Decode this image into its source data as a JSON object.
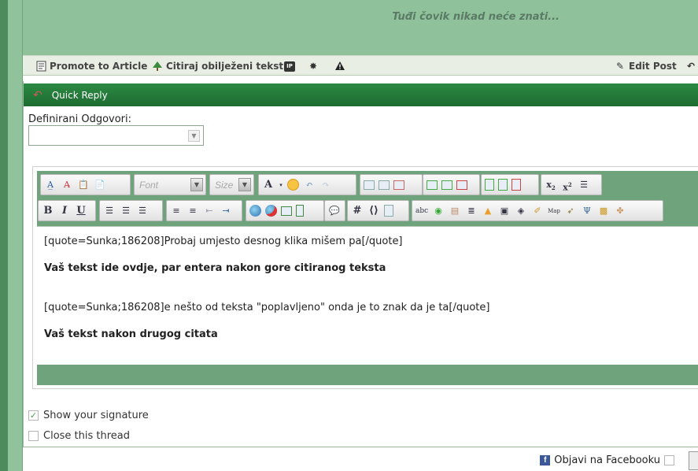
{
  "post": {
    "signature": "Tuđi čovik nikad neće znati...",
    "toolbar": {
      "promote_label": "Promote to Article",
      "quote_label": "Citiraj obilježeni tekst",
      "ip_label": "IP",
      "edit_label": "Edit Post"
    }
  },
  "quick_reply": {
    "title": "Quick Reply",
    "predefined_label": "Definirani Odgovori:",
    "predefined_value": ""
  },
  "editor": {
    "font_placeholder": "Font",
    "size_placeholder": "Size",
    "content": {
      "line1": "[quote=Sunka;186208]Probaj umjesto desnog klika mišem pa[/quote]",
      "line2": "Vaš tekst ide ovdje, par entera nakon gore citiranog teksta",
      "line3": "[quote=Sunka;186208]e nešto od teksta \"poplavljeno\" onda je to znak da je ta[/quote]",
      "line4": "Vaš tekst nakon drugog citata"
    }
  },
  "options": {
    "show_signature": "Show your signature",
    "show_signature_checked": true,
    "close_thread": "Close this thread",
    "close_thread_checked": false
  },
  "footer": {
    "facebook_label": "Objavi na Facebooku",
    "facebook_checked": false
  },
  "colors": {
    "header_green": "#2c8a43",
    "post_bg": "#8fc29a",
    "editor_frame": "#6fa37b"
  }
}
